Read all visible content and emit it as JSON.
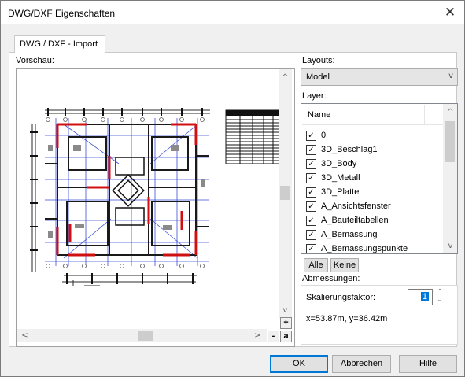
{
  "window": {
    "title": "DWG/DXF Eigenschaften"
  },
  "tabs": [
    {
      "label": "DWG / DXF - Import"
    }
  ],
  "preview": {
    "label": "Vorschau:"
  },
  "zoom": {
    "plus_label": "+",
    "minus_label": "-",
    "a_label": "a"
  },
  "layouts": {
    "label": "Layouts:",
    "selected": "Model"
  },
  "layer": {
    "label": "Layer:",
    "column_header": "Name",
    "items": [
      {
        "name": "0",
        "checked": true
      },
      {
        "name": "3D_Beschlag1",
        "checked": true
      },
      {
        "name": "3D_Body",
        "checked": true
      },
      {
        "name": "3D_Metall",
        "checked": true
      },
      {
        "name": "3D_Platte",
        "checked": true
      },
      {
        "name": "A_Ansichtsfenster",
        "checked": true
      },
      {
        "name": "A_Bauteiltabellen",
        "checked": true
      },
      {
        "name": "A_Bemassung",
        "checked": true
      },
      {
        "name": "A_Bemassungspunkte",
        "checked": true
      }
    ],
    "all_button": "Alle",
    "none_button": "Keine"
  },
  "dimensions": {
    "label": "Abmessungen:",
    "scale_label": "Skalierungsfaktor:",
    "scale_value": "1",
    "size_text": "x=53.87m, y=36.42m"
  },
  "buttons": {
    "ok": "OK",
    "cancel": "Abbrechen",
    "help": "Hilfe"
  },
  "colors": {
    "accent": "#0078d7",
    "drawing_red": "#d01010",
    "drawing_blue": "#3a4fd8"
  }
}
